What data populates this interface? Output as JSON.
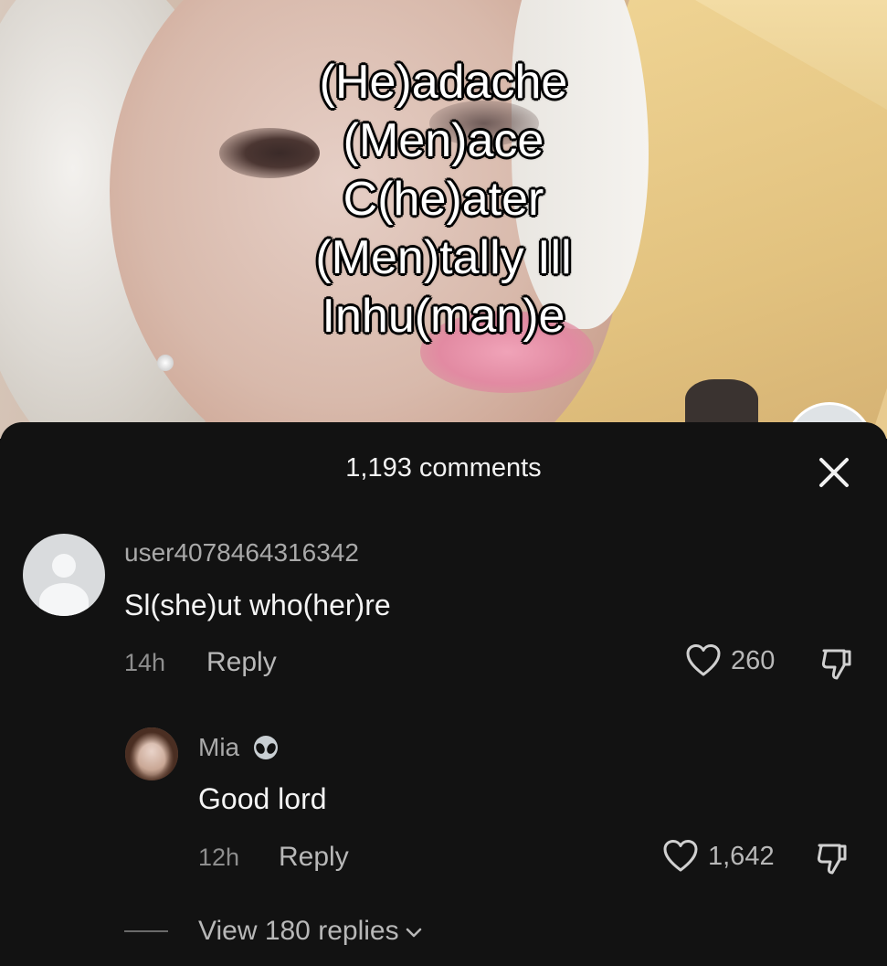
{
  "video": {
    "overlay_lines": [
      "(He)adache",
      "(Men)ace",
      "C(he)ater",
      "(Men)tally Ill",
      "Inhu(man)e"
    ]
  },
  "comments_sheet": {
    "title": "1,193 comments",
    "close_icon": "close-icon",
    "comments": [
      {
        "username": "user4078464316342",
        "text": "Sl(she)ut who(her)re",
        "time": "14h",
        "reply_label": "Reply",
        "likes": "260",
        "avatar": "default-avatar-icon"
      },
      {
        "username": "Mia",
        "badge": "alien-emoji",
        "text": "Good lord",
        "time": "12h",
        "reply_label": "Reply",
        "likes": "1,642",
        "avatar": "user-photo"
      }
    ],
    "view_replies_label": "View 180 replies"
  },
  "colors": {
    "sheet_background": "#121212",
    "primary_text": "#f4f4f4",
    "secondary_text": "#b8b8b8",
    "muted_text": "#8e8e8e"
  }
}
